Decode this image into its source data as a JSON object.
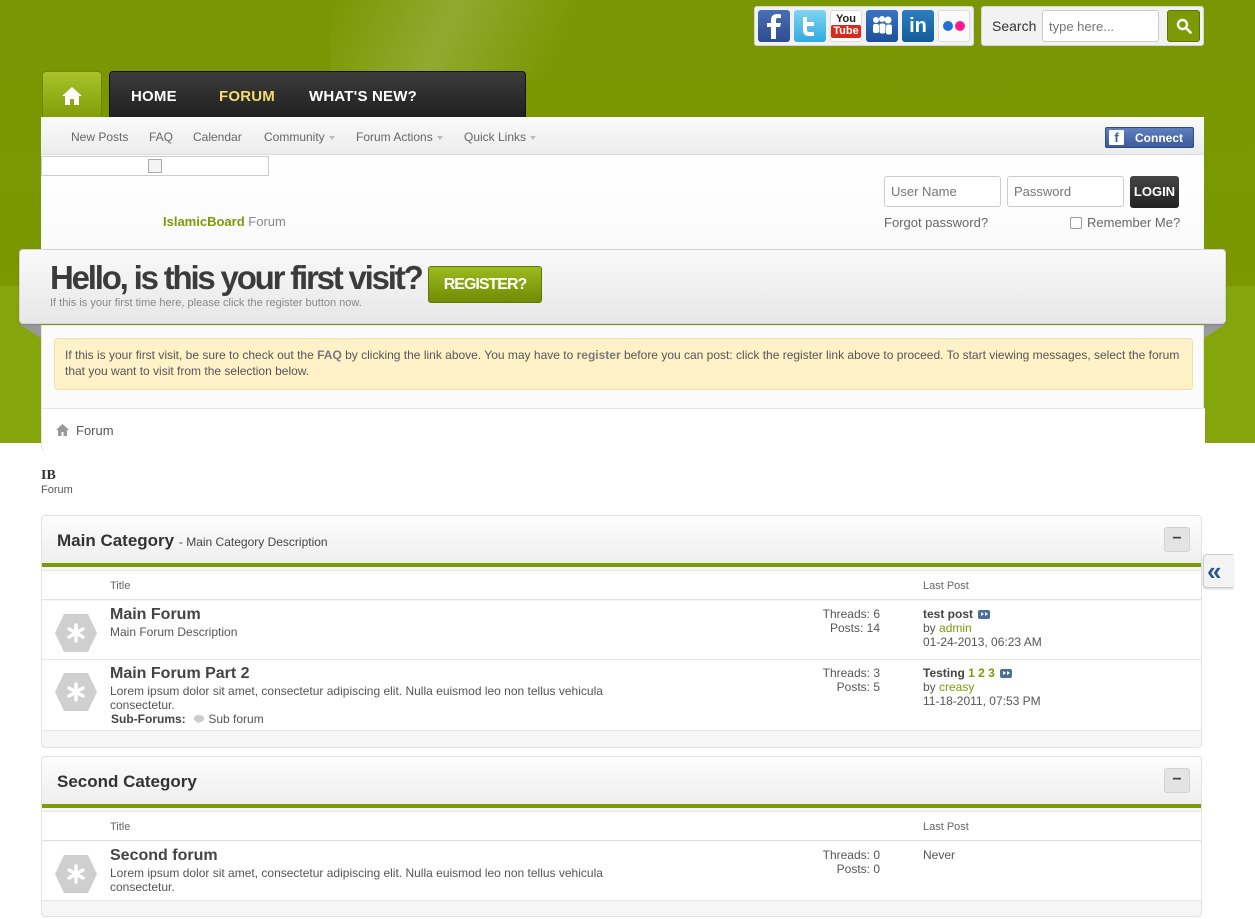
{
  "social": [
    "facebook-icon",
    "twitter-icon",
    "youtube-icon",
    "myspace-icon",
    "linkedin-icon",
    "flickr-icon"
  ],
  "search": {
    "label": "Search",
    "placeholder": "type here..."
  },
  "nav": {
    "home": "HOME",
    "forum": "FORUM",
    "whats_new": "WHAT'S NEW?"
  },
  "subnav": {
    "items": [
      "New Posts",
      "FAQ",
      "Calendar",
      "Community",
      "Forum Actions",
      "Quick Links"
    ],
    "connect": "Connect"
  },
  "site": {
    "brand": "IslamicBoard",
    "section": "Forum"
  },
  "login": {
    "username_placeholder": "User Name",
    "password_placeholder": "Password",
    "button": "LOGIN",
    "forgot": "Forgot password?",
    "remember": "Remember Me?"
  },
  "welcome": {
    "heading": "Hello, is this your first visit?",
    "subtext": "If this is your first time here, please click the register button now.",
    "register": "REGISTER?"
  },
  "notice": {
    "p1": "If this is your first visit, be sure to check out the ",
    "faq": "FAQ",
    "p2": " by clicking the link above. You may have to ",
    "register": "register",
    "p3": " before you can post: click the register link above to proceed. To start viewing messages, select the forum that you want to visit from the selection below."
  },
  "breadcrumb": "Forum",
  "page": {
    "title": "IB",
    "subtitle": "Forum"
  },
  "colors": {
    "brand_green": "#7d9a05",
    "dark_nav": "#2a2a2a",
    "notice_bg": "#fff2c8"
  },
  "categories": [
    {
      "name": "Main Category",
      "description": "- Main Category Description",
      "collapse": "−",
      "col_title": "Title",
      "col_last": "Last Post",
      "forums": [
        {
          "title": "Main Forum",
          "desc": "Main Forum Description",
          "threads": "Threads: 6",
          "posts": "Posts: 14",
          "last_title": "test post",
          "last_by": "by ",
          "last_user": "admin",
          "last_date": "01-24-2013, 06:23 AM"
        },
        {
          "title": "Main Forum Part 2",
          "desc": "Lorem ipsum dolor sit amet, consectetur adipiscing elit. Nulla euismod leo non tellus vehicula consectetur.",
          "subforums_label": "Sub-Forums:",
          "subforum": "Sub forum",
          "threads": "Threads: 3",
          "posts": "Posts: 5",
          "last_title": "Testing",
          "last_pages": "1 2 3",
          "last_by": "by ",
          "last_user": "creasy",
          "last_date": "11-18-2011, 07:53 PM"
        }
      ]
    },
    {
      "name": "Second Category",
      "collapse": "−",
      "col_title": "Title",
      "col_last": "Last Post",
      "forums": [
        {
          "title": "Second forum",
          "desc": "Lorem ipsum dolor sit amet, consectetur adipiscing elit. Nulla euismod leo non tellus vehicula consectetur.",
          "threads": "Threads: 0",
          "posts": "Posts: 0",
          "last_title": "Never"
        }
      ]
    }
  ],
  "sidetab": "«"
}
